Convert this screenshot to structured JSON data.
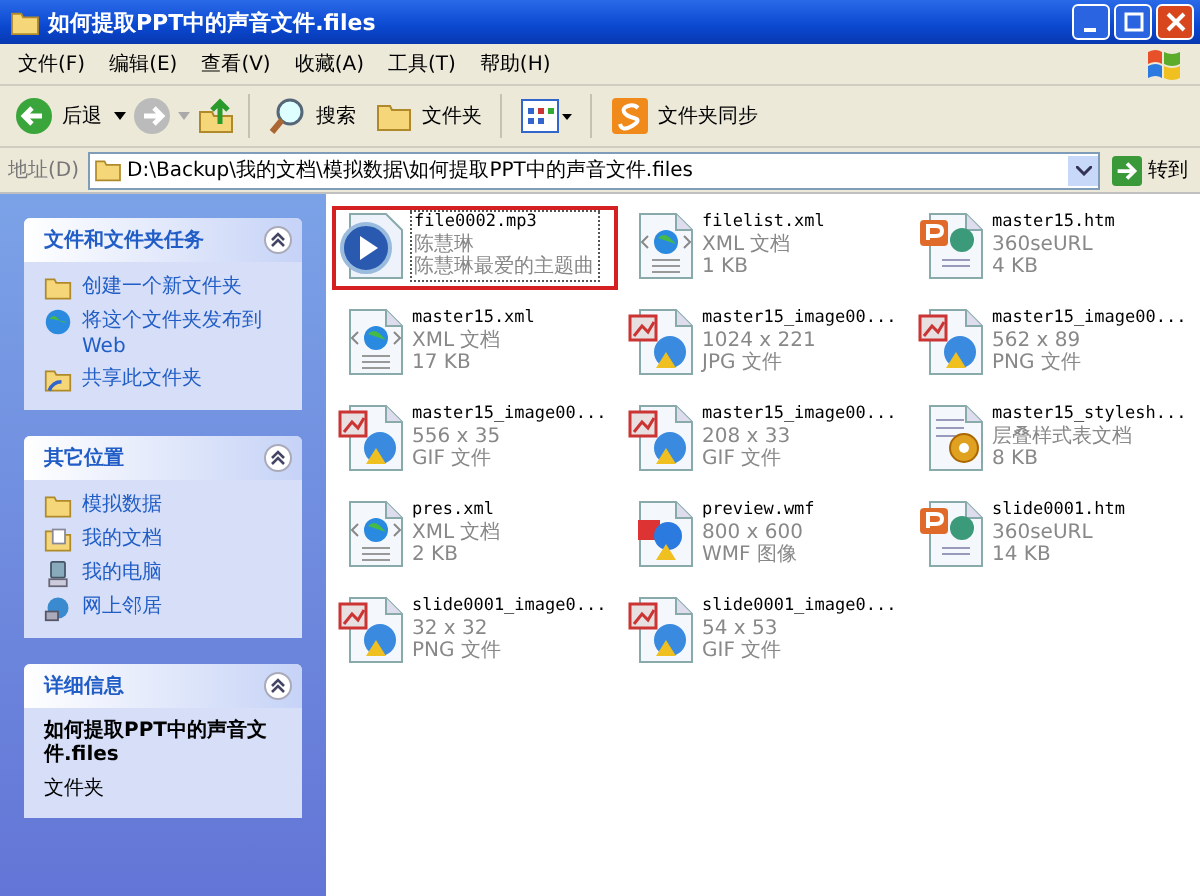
{
  "window": {
    "title": "如何提取PPT中的声音文件.files"
  },
  "menu": [
    "文件(F)",
    "编辑(E)",
    "查看(V)",
    "收藏(A)",
    "工具(T)",
    "帮助(H)"
  ],
  "toolbar": {
    "back": "后退",
    "search": "搜索",
    "folders": "文件夹",
    "sync": "文件夹同步"
  },
  "address": {
    "label": "地址(D)",
    "value": "D:\\Backup\\我的文档\\模拟数据\\如何提取PPT中的声音文件.files",
    "go": "转到"
  },
  "sidebar": [
    {
      "title": "文件和文件夹任务",
      "kind": "links",
      "items": [
        {
          "label": "创建一个新文件夹"
        },
        {
          "label": "将这个文件夹发布到 Web"
        },
        {
          "label": "共享此文件夹"
        }
      ]
    },
    {
      "title": "其它位置",
      "kind": "links",
      "items": [
        {
          "label": "模拟数据"
        },
        {
          "label": "我的文档"
        },
        {
          "label": "我的电脑"
        },
        {
          "label": "网上邻居"
        }
      ]
    },
    {
      "title": "详细信息",
      "kind": "details",
      "name": "如何提取PPT中的声音文件.files",
      "type": "文件夹"
    }
  ],
  "files": [
    {
      "name": "file0002.mp3",
      "lines": [
        "陈慧琳",
        "陈慧琳最爱的主题曲"
      ],
      "kind": "audio",
      "selected": true
    },
    {
      "name": "filelist.xml",
      "lines": [
        "XML 文档",
        "1 KB"
      ],
      "kind": "xml",
      "selected": false
    },
    {
      "name": "master15.htm",
      "lines": [
        "360seURL",
        "4 KB"
      ],
      "kind": "htm",
      "selected": false
    },
    {
      "name": "master15.xml",
      "lines": [
        "XML 文档",
        "17 KB"
      ],
      "kind": "xml",
      "selected": false
    },
    {
      "name": "master15_image00...",
      "lines": [
        "1024 x 221",
        "JPG 文件"
      ],
      "kind": "image",
      "selected": false
    },
    {
      "name": "master15_image00...",
      "lines": [
        "562 x 89",
        "PNG 文件"
      ],
      "kind": "image",
      "selected": false
    },
    {
      "name": "master15_image00...",
      "lines": [
        "556 x 35",
        "GIF 文件"
      ],
      "kind": "image",
      "selected": false
    },
    {
      "name": "master15_image00...",
      "lines": [
        "208 x 33",
        "GIF 文件"
      ],
      "kind": "image",
      "selected": false
    },
    {
      "name": "master15_stylesh...",
      "lines": [
        "层叠样式表文档",
        "8 KB"
      ],
      "kind": "css",
      "selected": false
    },
    {
      "name": "pres.xml",
      "lines": [
        "XML 文档",
        "2 KB"
      ],
      "kind": "xml",
      "selected": false
    },
    {
      "name": "preview.wmf",
      "lines": [
        "800 x 600",
        "WMF 图像"
      ],
      "kind": "wmf",
      "selected": false
    },
    {
      "name": "slide0001.htm",
      "lines": [
        "360seURL",
        "14 KB"
      ],
      "kind": "htm",
      "selected": false
    },
    {
      "name": "slide0001_image0...",
      "lines": [
        "32 x 32",
        "PNG 文件"
      ],
      "kind": "image",
      "selected": false
    },
    {
      "name": "slide0001_image0...",
      "lines": [
        "54 x 53",
        "GIF 文件"
      ],
      "kind": "image",
      "selected": false
    }
  ]
}
